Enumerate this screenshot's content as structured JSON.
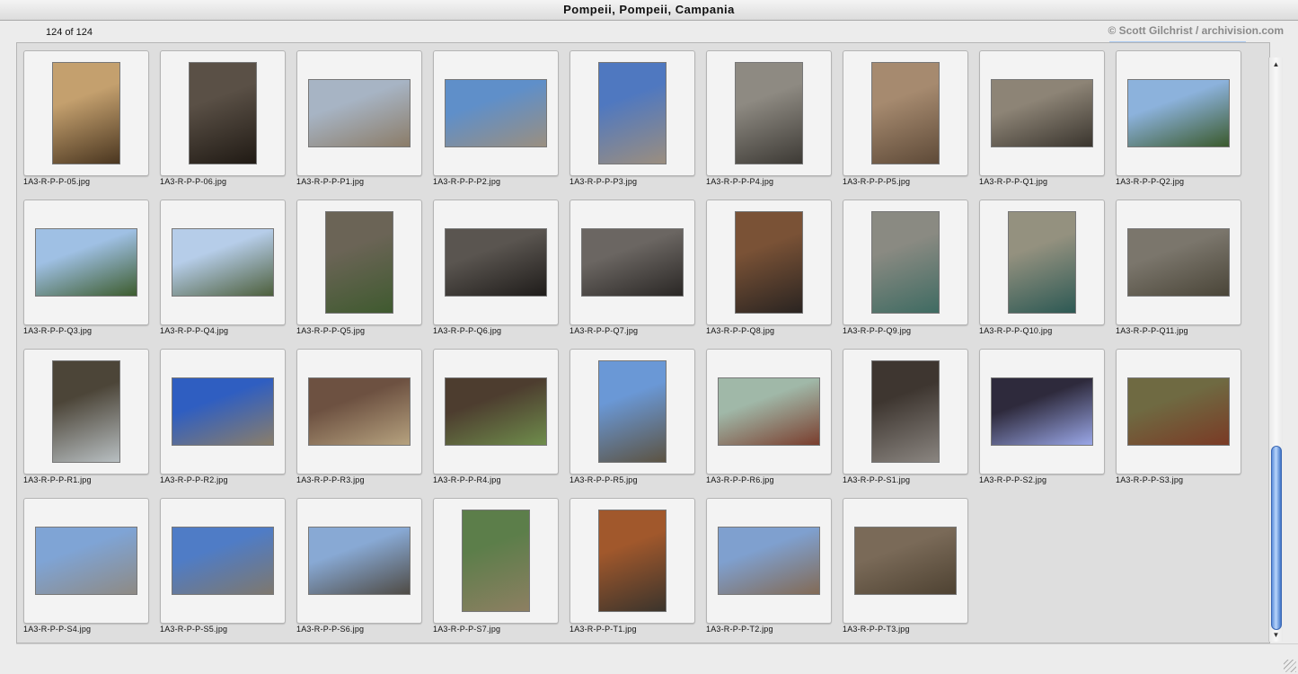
{
  "window": {
    "title": "Pompeii, Pompeii, Campania"
  },
  "info": {
    "count": "124 of 124",
    "copyright": "© Scott Gilchrist / archivision.com"
  },
  "thumbnails": [
    {
      "label": "1A3-R-P-P-05.jpg",
      "orient": "port",
      "colors": [
        "#c4a06e",
        "#4a3620"
      ]
    },
    {
      "label": "1A3-R-P-P-06.jpg",
      "orient": "port",
      "colors": [
        "#5a5046",
        "#201a14"
      ]
    },
    {
      "label": "1A3-R-P-P-P1.jpg",
      "orient": "land",
      "colors": [
        "#a7b4c4",
        "#8b7c68"
      ]
    },
    {
      "label": "1A3-R-P-P-P2.jpg",
      "orient": "land",
      "colors": [
        "#5f8fc9",
        "#9a8f80"
      ]
    },
    {
      "label": "1A3-R-P-P-P3.jpg",
      "orient": "port",
      "colors": [
        "#4f78c0",
        "#9b8e7f"
      ]
    },
    {
      "label": "1A3-R-P-P-P4.jpg",
      "orient": "port",
      "colors": [
        "#8e8a82",
        "#3d3a35"
      ]
    },
    {
      "label": "1A3-R-P-P-P5.jpg",
      "orient": "port",
      "colors": [
        "#a68a6f",
        "#5e4a38"
      ]
    },
    {
      "label": "1A3-R-P-P-Q1.jpg",
      "orient": "land",
      "colors": [
        "#8d8476",
        "#3a352e"
      ]
    },
    {
      "label": "1A3-R-P-P-Q2.jpg",
      "orient": "land",
      "colors": [
        "#8cb2dc",
        "#3b5a2d"
      ]
    },
    {
      "label": "1A3-R-P-P-Q3.jpg",
      "orient": "land",
      "colors": [
        "#9fc0e4",
        "#3d5c2e"
      ]
    },
    {
      "label": "1A3-R-P-P-Q4.jpg",
      "orient": "land",
      "colors": [
        "#b6cde9",
        "#4d5f3c"
      ]
    },
    {
      "label": "1A3-R-P-P-Q5.jpg",
      "orient": "port",
      "colors": [
        "#6b6456",
        "#3f5a2f"
      ]
    },
    {
      "label": "1A3-R-P-P-Q6.jpg",
      "orient": "land",
      "colors": [
        "#5a5550",
        "#1f1c1a"
      ]
    },
    {
      "label": "1A3-R-P-P-Q7.jpg",
      "orient": "land",
      "colors": [
        "#6b6662",
        "#2a2725"
      ]
    },
    {
      "label": "1A3-R-P-P-Q8.jpg",
      "orient": "port",
      "colors": [
        "#7a5236",
        "#2a2421"
      ]
    },
    {
      "label": "1A3-R-P-P-Q9.jpg",
      "orient": "port",
      "colors": [
        "#8a8a82",
        "#3f6b62"
      ]
    },
    {
      "label": "1A3-R-P-P-Q10.jpg",
      "orient": "port",
      "colors": [
        "#94917f",
        "#2d5954"
      ]
    },
    {
      "label": "1A3-R-P-P-Q11.jpg",
      "orient": "land",
      "colors": [
        "#7b766c",
        "#4a4538"
      ]
    },
    {
      "label": "1A3-R-P-P-R1.jpg",
      "orient": "port",
      "colors": [
        "#4c4538",
        "#b8bfc2"
      ]
    },
    {
      "label": "1A3-R-P-P-R2.jpg",
      "orient": "land",
      "colors": [
        "#2f5ec1",
        "#8a7e6a"
      ]
    },
    {
      "label": "1A3-R-P-P-R3.jpg",
      "orient": "land",
      "colors": [
        "#6d5141",
        "#b6a27f"
      ]
    },
    {
      "label": "1A3-R-P-P-R4.jpg",
      "orient": "land",
      "colors": [
        "#4d3d2f",
        "#6f8d4c"
      ]
    },
    {
      "label": "1A3-R-P-P-R5.jpg",
      "orient": "port",
      "colors": [
        "#6a98d6",
        "#5c5342"
      ]
    },
    {
      "label": "1A3-R-P-P-R6.jpg",
      "orient": "land",
      "colors": [
        "#a0b8a8",
        "#7a3d2d"
      ]
    },
    {
      "label": "1A3-R-P-P-S1.jpg",
      "orient": "port",
      "colors": [
        "#3e3630",
        "#8a8580"
      ]
    },
    {
      "label": "1A3-R-P-P-S2.jpg",
      "orient": "land",
      "colors": [
        "#2e2a3c",
        "#9aa7e8"
      ]
    },
    {
      "label": "1A3-R-P-P-S3.jpg",
      "orient": "land",
      "colors": [
        "#6f6a42",
        "#7a3a25"
      ]
    },
    {
      "label": "1A3-R-P-P-S4.jpg",
      "orient": "land",
      "colors": [
        "#7fa4d5",
        "#8e8a84"
      ]
    },
    {
      "label": "1A3-R-P-P-S5.jpg",
      "orient": "land",
      "colors": [
        "#4f7cc6",
        "#7e786e"
      ]
    },
    {
      "label": "1A3-R-P-P-S6.jpg",
      "orient": "land",
      "colors": [
        "#88a9d4",
        "#4f4b45"
      ]
    },
    {
      "label": "1A3-R-P-P-S7.jpg",
      "orient": "port",
      "colors": [
        "#5c7e4a",
        "#8d7f62"
      ]
    },
    {
      "label": "1A3-R-P-P-T1.jpg",
      "orient": "port",
      "colors": [
        "#a1582c",
        "#3b342c"
      ]
    },
    {
      "label": "1A3-R-P-P-T2.jpg",
      "orient": "land",
      "colors": [
        "#7fa0cf",
        "#826a55"
      ]
    },
    {
      "label": "1A3-R-P-P-T3.jpg",
      "orient": "land",
      "colors": [
        "#7a6a58",
        "#4e4232"
      ]
    }
  ]
}
